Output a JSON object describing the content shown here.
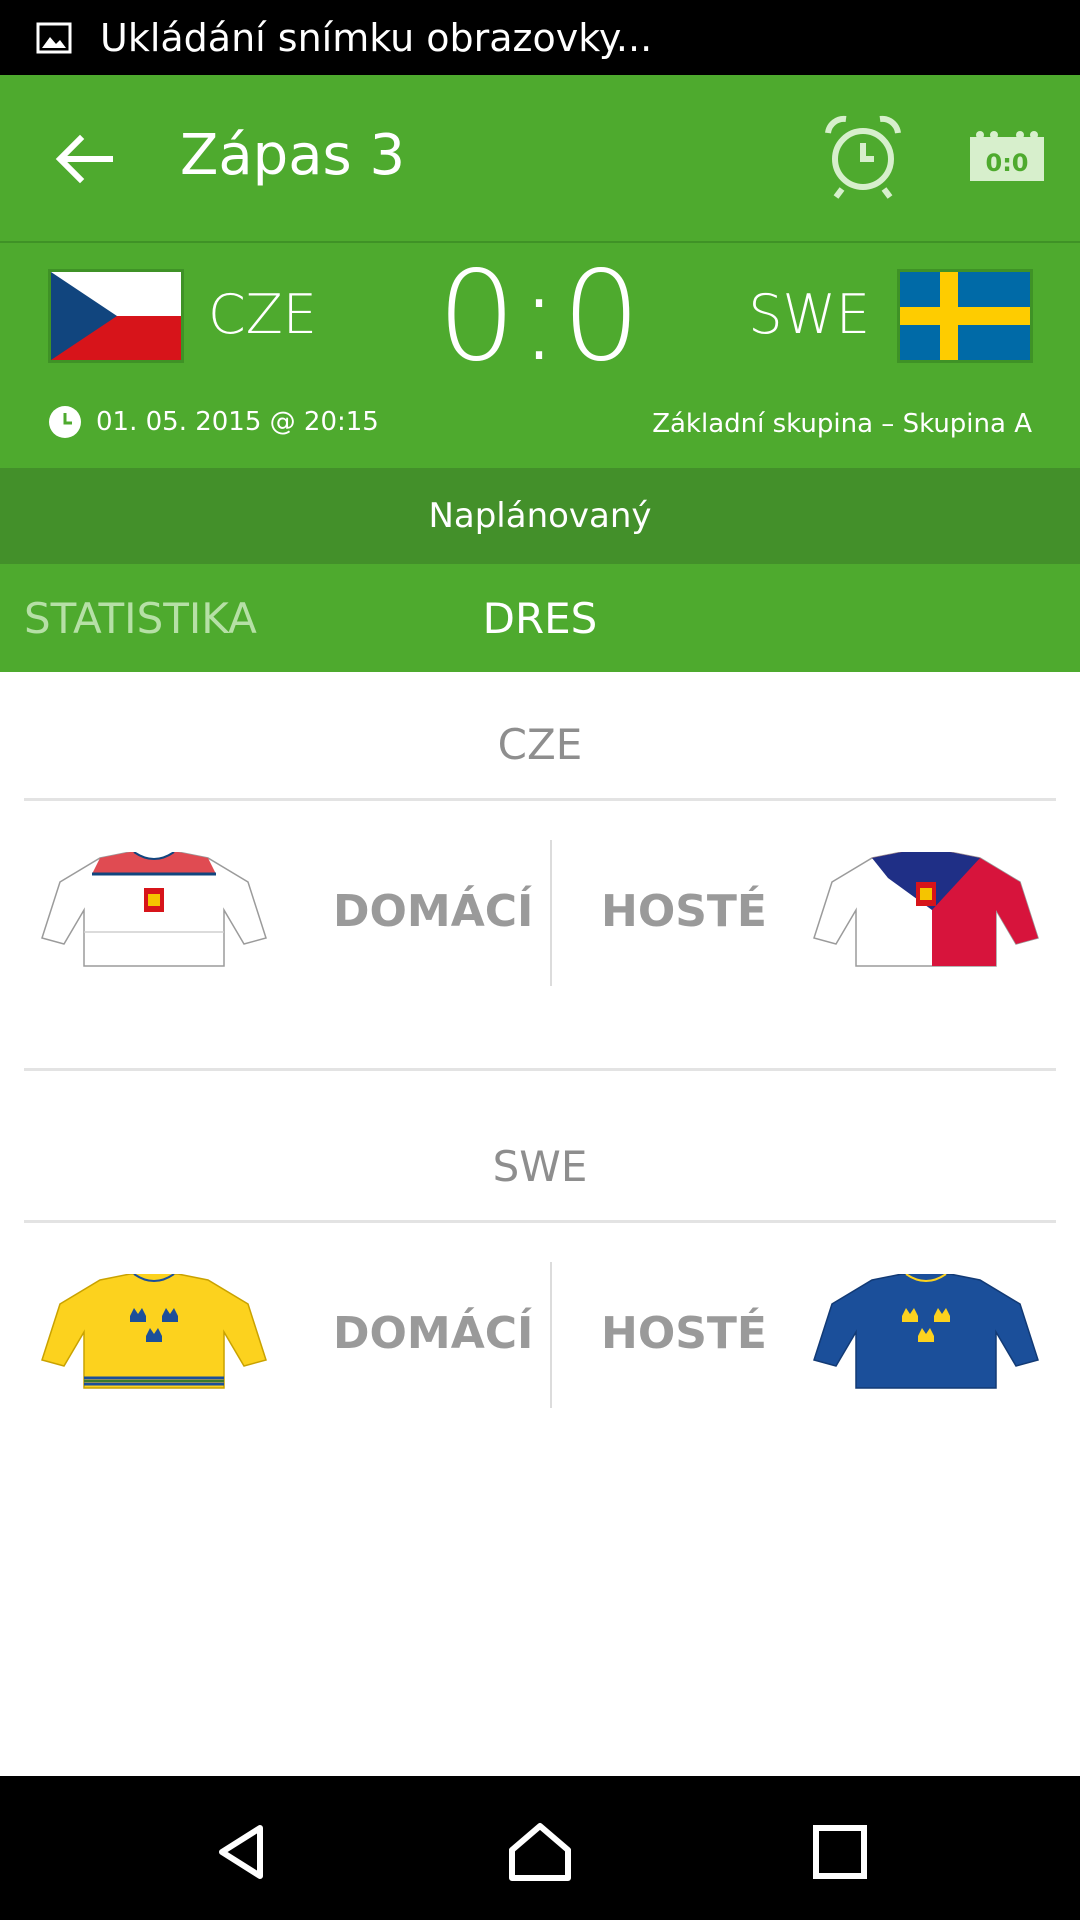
{
  "status_bar": {
    "text": "Ukládání snímku obrazovky..."
  },
  "app_bar": {
    "title": "Zápas 3",
    "score_icon_text": "0:0"
  },
  "match": {
    "home_code": "CZE",
    "away_code": "SWE",
    "score": "0:0",
    "datetime": "01. 05. 2015  @ 20:15",
    "group": "Základní skupina – Skupina A",
    "state": "Naplánovaný"
  },
  "tabs": [
    {
      "label": "STATISTIKA",
      "active": false
    },
    {
      "label": "DRES",
      "active": true
    }
  ],
  "jerseys": {
    "cze": {
      "title": "CZE",
      "home_label": "DOMÁCÍ",
      "away_label": "HOSTÉ"
    },
    "swe": {
      "title": "SWE",
      "home_label": "DOMÁCÍ",
      "away_label": "HOSTÉ"
    }
  },
  "colors": {
    "primary_green": "#4eaa2e",
    "dark_green": "#43902a",
    "label_gray": "#9a9a9a"
  }
}
